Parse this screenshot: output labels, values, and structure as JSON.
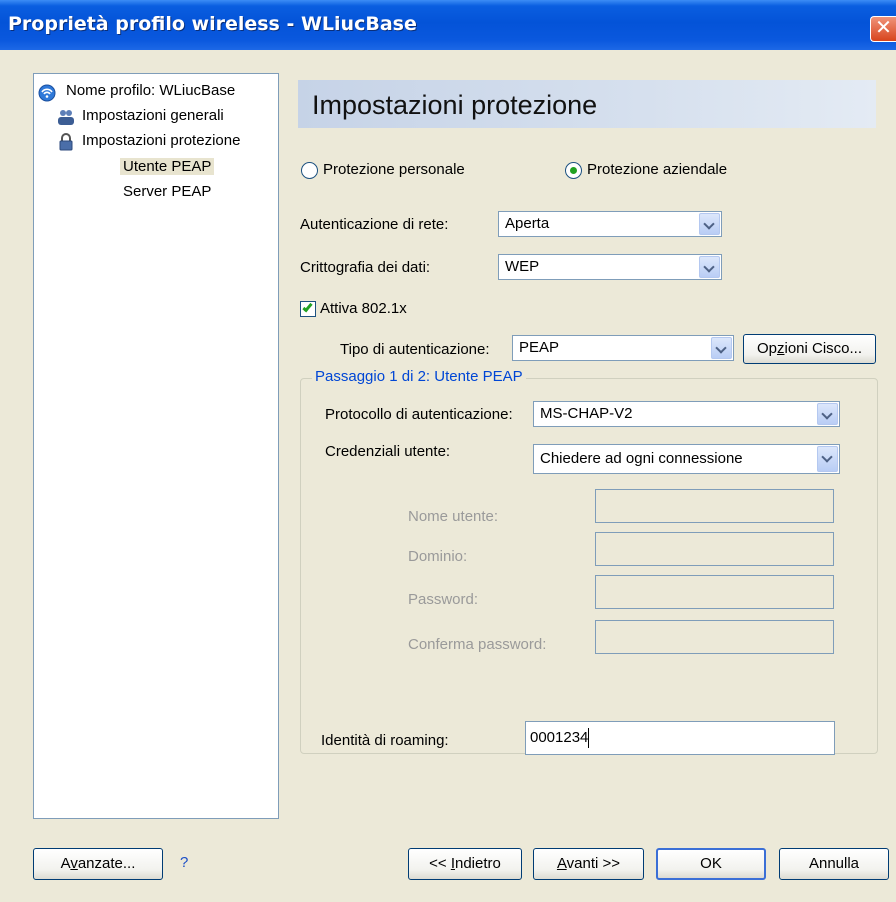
{
  "window": {
    "title": "Proprietà profilo wireless - WLiucBase",
    "close_glyph": "✕"
  },
  "tree": {
    "root": "Nome profilo: WLiucBase",
    "general": "Impostazioni generali",
    "security": "Impostazioni protezione",
    "peap_user": "Utente PEAP",
    "peap_server": "Server PEAP"
  },
  "header": {
    "title": "Impostazioni protezione"
  },
  "protection": {
    "personal": "Protezione personale",
    "enterprise": "Protezione aziendale",
    "selected": "enterprise"
  },
  "network_auth": {
    "label": "Autenticazione di rete:",
    "value": "Aperta"
  },
  "encryption": {
    "label": "Crittografia dei dati:",
    "value": "WEP"
  },
  "enable_8021x": {
    "label": "Attiva 802.1x",
    "checked": true
  },
  "auth_type": {
    "label": "Tipo di autenticazione:",
    "value": "PEAP"
  },
  "cisco_button": {
    "pre": "Op",
    "ul": "z",
    "post": "ioni Cisco..."
  },
  "group": {
    "legend": "Passaggio 1 di 2: Utente PEAP",
    "protocol": {
      "label": "Protocollo di autenticazione:",
      "value": "MS-CHAP-V2"
    },
    "credentials": {
      "label": "Credenziali utente:",
      "value": "Chiedere ad ogni connessione"
    },
    "username_label": "Nome utente:",
    "domain_label": "Dominio:",
    "password_label": "Password:",
    "confirm_label": "Conferma password:",
    "roaming": {
      "label": "Identità di roaming:",
      "value": "0001234"
    }
  },
  "buttons": {
    "advanced": {
      "pre": "A",
      "ul": "v",
      "post": "anzate..."
    },
    "help": "?",
    "back": {
      "pre": "<< ",
      "ul": "I",
      "post": "ndietro"
    },
    "next": {
      "pre": "",
      "ul": "A",
      "post": "vanti >>"
    },
    "ok": "OK",
    "cancel": "Annulla"
  },
  "colors": {
    "title_bar": "#0453d8",
    "window_bg": "#ece9d8",
    "group_legend": "#0046d5",
    "check_green": "#21a121"
  },
  "icons": {
    "root": "wireless-profile-icon",
    "general": "users-icon",
    "security": "lock-icon"
  }
}
